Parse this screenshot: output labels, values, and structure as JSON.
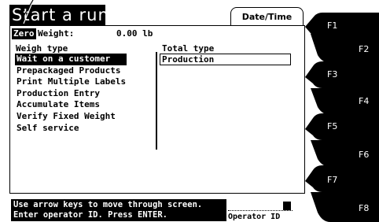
{
  "header": {
    "title": "Start a run",
    "date_time_tab": "Date/Time"
  },
  "scale": {
    "zero_badge": "Zero",
    "weight_label": "Weight:",
    "weight_value": "0.00 lb"
  },
  "weigh_type": {
    "header": "Weigh type",
    "selected_index": 0,
    "items": [
      {
        "label": "Wait on a customer"
      },
      {
        "label": "Prepackaged Products"
      },
      {
        "label": "Print Multiple Labels"
      },
      {
        "label": "Production Entry"
      },
      {
        "label": "Accumulate Items"
      },
      {
        "label": "Verify Fixed Weight"
      },
      {
        "label": "Self service"
      }
    ]
  },
  "total_type": {
    "header": "Total type",
    "value": "Production"
  },
  "status": {
    "line1": "Use arrow keys to move through screen.",
    "line2": "Enter operator ID. Press ENTER."
  },
  "operator": {
    "label": "Operator ID",
    "value": ""
  },
  "function_keys": [
    {
      "label": "F1"
    },
    {
      "label": "F2"
    },
    {
      "label": "F3"
    },
    {
      "label": "F4"
    },
    {
      "label": "F5"
    },
    {
      "label": "F6"
    },
    {
      "label": "F7"
    },
    {
      "label": "F8"
    }
  ]
}
